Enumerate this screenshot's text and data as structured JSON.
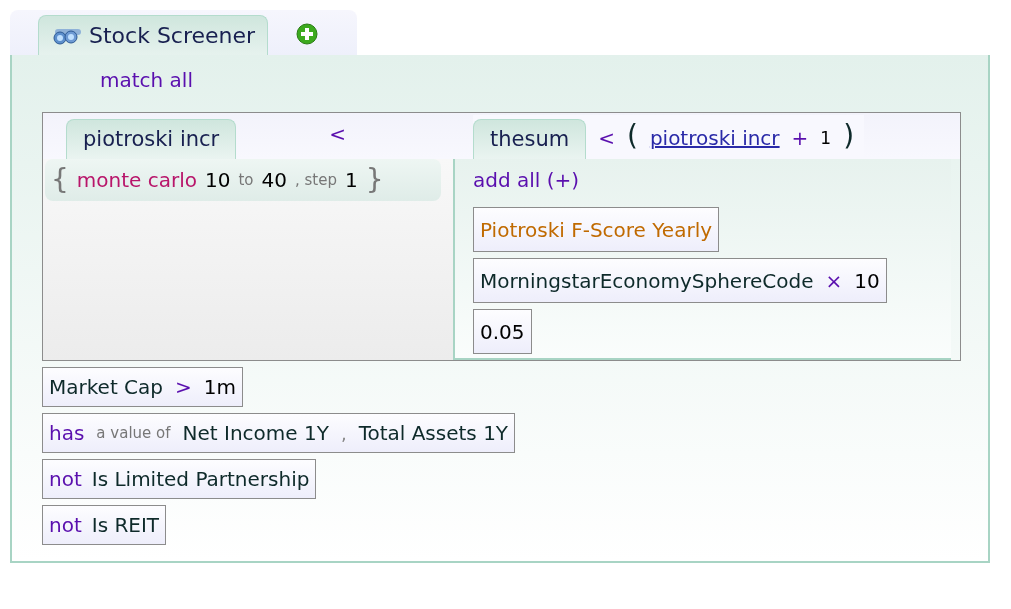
{
  "tabs": [
    {
      "label": "Stock Screener",
      "selected": true
    }
  ],
  "match_mode": "match all",
  "comparison": {
    "left_tab": {
      "label": "piotroski incr",
      "selected": true
    },
    "operator": "<",
    "right_tab": {
      "label": "thesum",
      "selected": true
    },
    "right_expression": [
      {
        "kind": "operator",
        "text": "<"
      },
      {
        "kind": "paren",
        "text": "("
      },
      {
        "kind": "link",
        "text": "piotroski incr"
      },
      {
        "kind": "operator",
        "text": "+"
      },
      {
        "kind": "number",
        "text": "1"
      },
      {
        "kind": "paren",
        "text": ")"
      }
    ],
    "left_body": {
      "open": "{",
      "name": "monte carlo",
      "from": "10",
      "to_label": "to",
      "to": "40",
      "step_label": ", step",
      "step": "1",
      "close": "}"
    },
    "right_body": {
      "title": "add all (+)",
      "terms": [
        {
          "kind": "field",
          "text": "Piotroski F-Score Yearly"
        },
        {
          "kind": "product",
          "text": "MorningstarEconomySphereCode",
          "op": "×",
          "value": "10"
        },
        {
          "kind": "number",
          "text": "0.05"
        }
      ]
    }
  },
  "conditions": [
    {
      "kind": "compare",
      "field": "Market Cap",
      "op": ">",
      "value": "1m"
    },
    {
      "kind": "has",
      "keyword": "has",
      "note": "a value of",
      "fields": [
        "Net Income 1Y",
        "Total Assets 1Y"
      ],
      "separator": ","
    },
    {
      "kind": "not",
      "keyword": "not",
      "field": "Is Limited Partnership"
    },
    {
      "kind": "not",
      "keyword": "not",
      "field": "Is REIT"
    }
  ]
}
